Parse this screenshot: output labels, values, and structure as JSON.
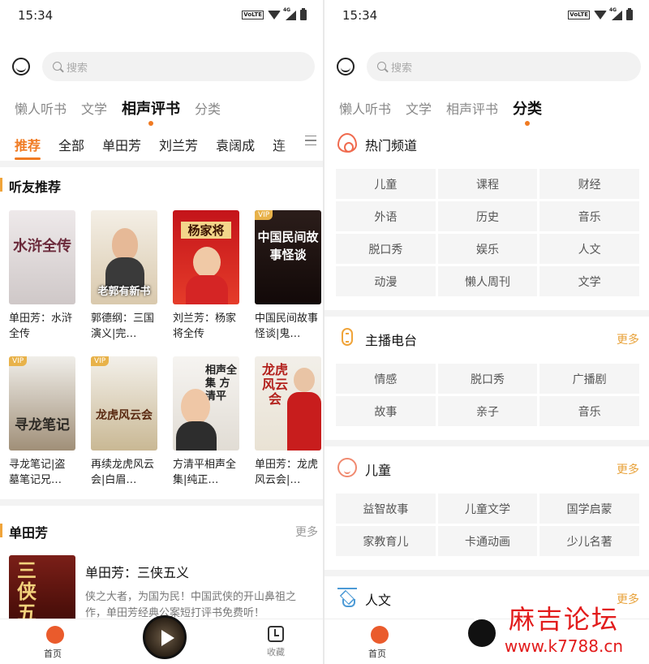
{
  "left": {
    "status": {
      "time": "15:34",
      "volte": "VoLTE",
      "network": "4G"
    },
    "search": {
      "placeholder": "搜索"
    },
    "main_tabs": [
      "懒人听书",
      "文学",
      "相声评书",
      "分类"
    ],
    "sub_tabs": [
      "推荐",
      "全部",
      "单田芳",
      "刘兰芳",
      "袁阔成",
      "连"
    ],
    "section1": {
      "title": "听友推荐",
      "books": [
        {
          "title": "单田芳：水浒全传",
          "cover_text": "水浒全传",
          "vip": false
        },
        {
          "title": "郭德纲：三国演义|完…",
          "cover_text": "老郭有新书",
          "vip": false
        },
        {
          "title": "刘兰芳：杨家将全传",
          "cover_text": "杨家将",
          "vip": false
        },
        {
          "title": "中国民间故事怪谈|鬼…",
          "cover_text": "中国民间故事怪谈",
          "vip": true
        },
        {
          "title": "寻龙笔记|盗墓笔记兄…",
          "cover_text": "寻龙笔记",
          "vip": true
        },
        {
          "title": "再续龙虎风云会|白眉…",
          "cover_text": "龙虎风云会",
          "vip": true
        },
        {
          "title": "方清平相声全集|纯正…",
          "cover_text": "相声全集 方清平",
          "vip": false
        },
        {
          "title": "单田芳：龙虎风云会|…",
          "cover_text": "龙虎风云会",
          "vip": false
        }
      ],
      "vip_label": "VIP"
    },
    "section2": {
      "title": "单田芳",
      "more": "更多",
      "featured": {
        "title": "单田芳：三侠五义",
        "cover_text": "三侠五",
        "description": "侠之大者，为国为民！中国武侠的开山鼻祖之作，单田芳经典公案短打评书免费听！"
      }
    },
    "bottom": {
      "home": "首页",
      "favorites": "收藏"
    }
  },
  "right": {
    "status": {
      "time": "15:34",
      "volte": "VoLTE",
      "network": "4G"
    },
    "search": {
      "placeholder": "搜索"
    },
    "main_tabs": [
      "懒人听书",
      "文学",
      "相声评书",
      "分类"
    ],
    "sections": [
      {
        "title": "热门频道",
        "more": "",
        "icon": "fire-icon",
        "items": [
          "儿童",
          "课程",
          "财经",
          "外语",
          "历史",
          "音乐",
          "脱口秀",
          "娱乐",
          "人文",
          "动漫",
          "懒人周刊",
          "文学"
        ]
      },
      {
        "title": "主播电台",
        "more": "更多",
        "icon": "microphone-icon",
        "items": [
          "情感",
          "脱口秀",
          "广播剧",
          "故事",
          "亲子",
          "音乐"
        ]
      },
      {
        "title": "儿童",
        "more": "更多",
        "icon": "baby-face-icon",
        "items": [
          "益智故事",
          "儿童文学",
          "国学启蒙",
          "家教育儿",
          "卡通动画",
          "少儿名著"
        ]
      },
      {
        "title": "人文",
        "more": "更多",
        "icon": "graduation-cap-icon",
        "items": []
      }
    ],
    "bottom": {
      "home": "首页"
    },
    "watermark": {
      "line1": "麻吉论坛",
      "line2": "www.k7788.cn"
    }
  },
  "colors": {
    "accent": "#f07a22",
    "more": "#e8a23a",
    "vip": "#e8b24a",
    "watermark": "#e21b1b"
  }
}
